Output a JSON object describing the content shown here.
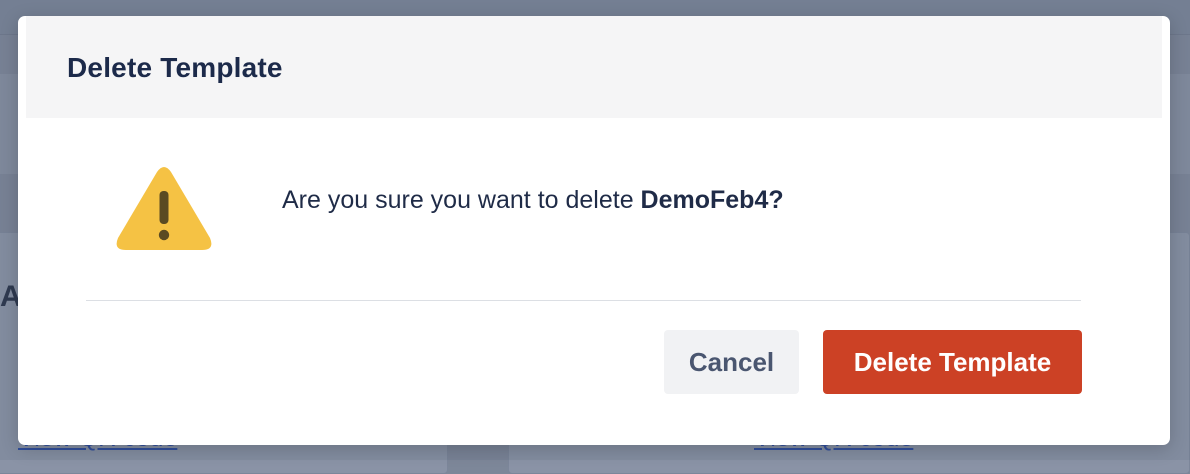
{
  "background": {
    "heading_fragment": "AP",
    "card_links": [
      "View QR code",
      "View QR code"
    ]
  },
  "dialog": {
    "title": "Delete Template",
    "icon": "warning-icon",
    "message_prefix": "Are you sure you want to delete ",
    "template_name": "DemoFeb4",
    "message_suffix": "?",
    "cancel_label": "Cancel",
    "confirm_label": "Delete Template"
  },
  "colors": {
    "title_text": "#1c2a4a",
    "warning_fill": "#f5c244",
    "warning_mark": "#5a4a22",
    "danger_button": "#cc4125",
    "cancel_button_bg": "#f1f2f4"
  }
}
